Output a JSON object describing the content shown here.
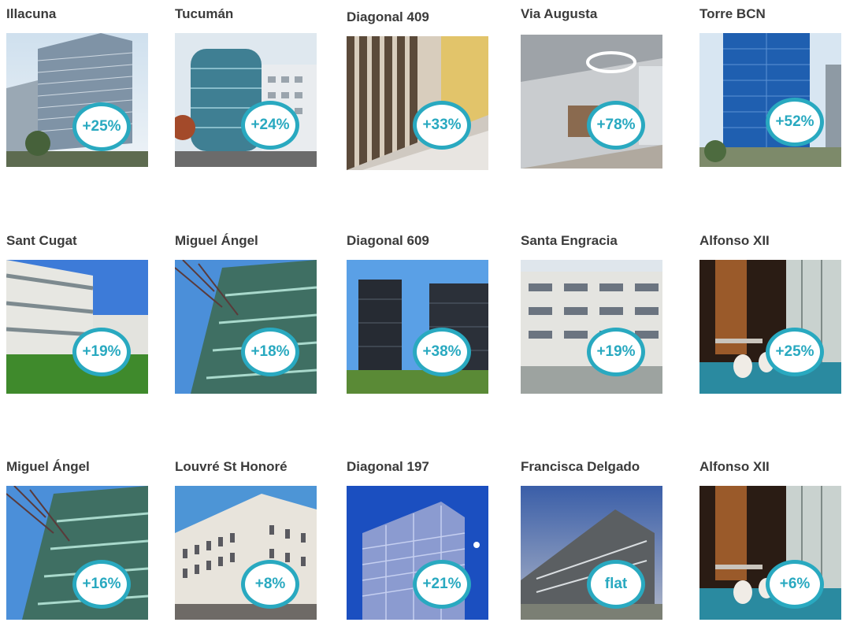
{
  "properties": [
    {
      "name": "Illacuna",
      "change": "+25%"
    },
    {
      "name": "Tucumán",
      "change": "+24%"
    },
    {
      "name": "Diagonal 409",
      "change": "+33%"
    },
    {
      "name": "Via Augusta",
      "change": "+78%"
    },
    {
      "name": "Torre BCN",
      "change": "+52%"
    },
    {
      "name": "Sant Cugat",
      "change": "+19%"
    },
    {
      "name": "Miguel Ángel",
      "change": "+18%"
    },
    {
      "name": "Diagonal 609",
      "change": "+38%"
    },
    {
      "name": "Santa Engracia",
      "change": "+19%"
    },
    {
      "name": "Alfonso XII",
      "change": "+25%"
    },
    {
      "name": "Miguel Ángel",
      "change": "+16%"
    },
    {
      "name": "Louvré St Honoré",
      "change": "+8%"
    },
    {
      "name": "Diagonal 197",
      "change": "+21%"
    },
    {
      "name": "Francisca Delgado",
      "change": "flat"
    },
    {
      "name": "Alfonso XII",
      "change": "+6%"
    }
  ],
  "colors": {
    "badge_ring": "#29a9c0",
    "badge_text": "#29a9c0",
    "title_text": "#3b3b3b"
  }
}
